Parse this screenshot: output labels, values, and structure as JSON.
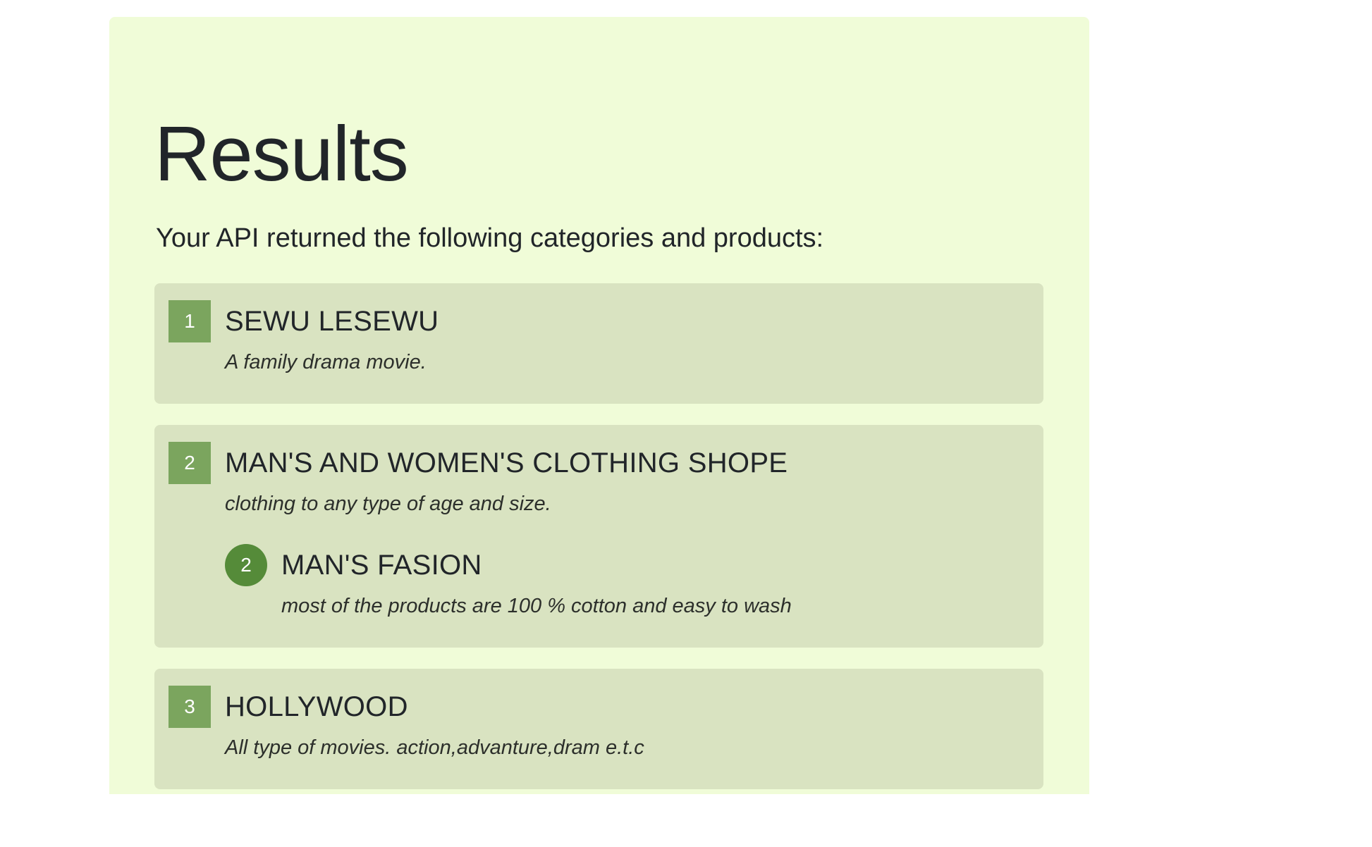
{
  "page": {
    "title": "Results",
    "subtitle": "Your API returned the following categories and products:"
  },
  "categories": [
    {
      "number": "1",
      "name": "SEWU LESEWU",
      "description": "A family drama movie."
    },
    {
      "number": "2",
      "name": "MAN'S AND WOMEN'S CLOTHING SHOPE",
      "description": "clothing to any type of age and size.",
      "products": [
        {
          "number": "2",
          "name": "MAN'S FASION",
          "description": "most of the products are 100 % cotton and easy to wash"
        }
      ]
    },
    {
      "number": "3",
      "name": "HOLLYWOOD",
      "description": "All type of movies. action,advanture,dram e.t.c"
    }
  ],
  "colors": {
    "panel_background": "#f0fcd8",
    "card_background": "#d9e3c1",
    "category_badge": "#7ba55e",
    "product_badge": "#558b39"
  }
}
